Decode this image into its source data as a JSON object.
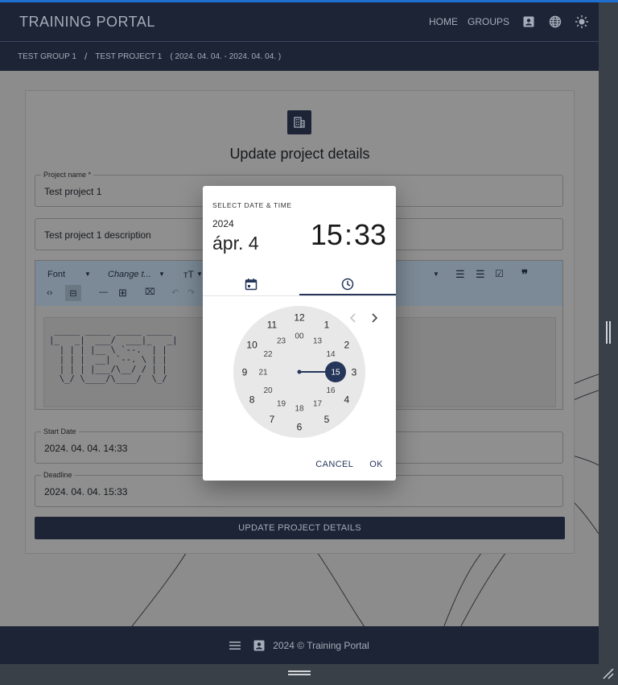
{
  "app": {
    "brand": "TRAINING PORTAL",
    "nav": [
      {
        "label": "HOME"
      },
      {
        "label": "GROUPS"
      }
    ],
    "nav_icons": [
      "contact-card-icon",
      "globe-icon",
      "sun-icon"
    ]
  },
  "breadcrumb": {
    "group": "TEST GROUP 1",
    "separator": "/",
    "project": "TEST PROJECT 1",
    "range": "( 2024. 04. 04. - 2024. 04. 04. )"
  },
  "form": {
    "title": "Update project details",
    "project_name_label": "Project name *",
    "project_name_value": "Test project 1",
    "description_value": "Test project 1 description",
    "toolbar": {
      "font_label": "Font",
      "change_label": "Change t..."
    },
    "ascii_art": " _____ _____ _____ _____\n|_   _|  ___/  ___|_   _|\n  | | | |__ \\ `--.  | |\n  | | |  __| `--. \\ | |\n  | | | |___/\\__/ / | |\n  \\_/ \\____/\\____/  \\_/",
    "start_date_label": "Start Date",
    "start_date_value": "2024. 04. 04. 14:33",
    "deadline_label": "Deadline",
    "deadline_value": "2024. 04. 04. 15:33",
    "submit_label": "UPDATE PROJECT DETAILS"
  },
  "footer": {
    "text": "2024 © Training Portal"
  },
  "dialog": {
    "caption": "SELECT DATE & TIME",
    "year": "2024",
    "date": "ápr. 4",
    "hour": "15",
    "minute": "33",
    "separator": ":",
    "tabs": [
      "calendar-icon",
      "clock-icon"
    ],
    "active_tab": "clock",
    "clock_numbers_outer": [
      "12",
      "1",
      "2",
      "3",
      "4",
      "5",
      "6",
      "7",
      "8",
      "9",
      "10",
      "11"
    ],
    "clock_numbers_inner": [
      "00",
      "13",
      "14",
      "15",
      "16",
      "17",
      "18",
      "19",
      "20",
      "21",
      "22",
      "23"
    ],
    "selected_hour": "15",
    "cancel_label": "CANCEL",
    "ok_label": "OK"
  },
  "colors": {
    "header": "#1c2435",
    "accent": "#26365a",
    "dialog_bg": "#ffffff"
  }
}
